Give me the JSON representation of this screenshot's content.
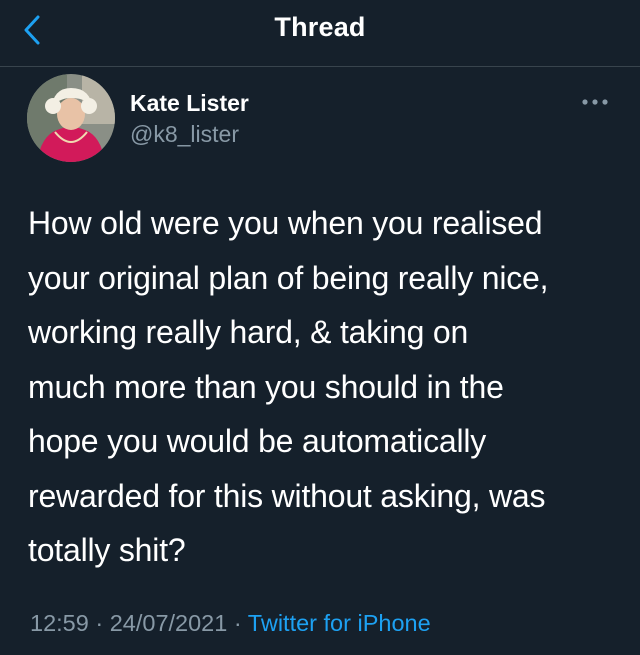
{
  "header": {
    "title": "Thread",
    "back_icon": "chevron-left-icon"
  },
  "author": {
    "name": "Kate Lister",
    "handle": "@k8_lister",
    "avatar_icon": "avatar"
  },
  "tweet": {
    "lines": [
      "How old were you when you realised",
      "your original plan of being really nice,",
      "working really hard, & taking on",
      "much more than you should in the",
      "hope you would be automatically",
      "rewarded for this without asking, was",
      "totally shit?"
    ]
  },
  "meta": {
    "time": "12:59",
    "separator": " · ",
    "date": "24/07/2021",
    "source": "Twitter for iPhone"
  },
  "colors": {
    "background": "#15202b",
    "text": "#ffffff",
    "secondary": "#8899a6",
    "accent": "#1da1f2",
    "divider": "#38444d"
  }
}
